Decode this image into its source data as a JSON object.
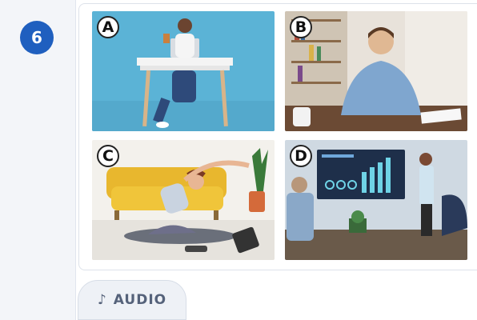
{
  "question": {
    "number": "6"
  },
  "options": [
    {
      "letter": "A",
      "icon": "person-at-desk-laptop-image"
    },
    {
      "letter": "B",
      "icon": "man-at-table-image"
    },
    {
      "letter": "C",
      "icon": "woman-yoga-stretch-image"
    },
    {
      "letter": "D",
      "icon": "business-meeting-presentation-image"
    }
  ],
  "audio": {
    "icon": "music-note-icon",
    "note_glyph": "♪",
    "label": "AUDIO"
  },
  "colors": {
    "badge": "#1f5fbf",
    "rail": "#f3f5f9",
    "audio_text": "#55627a"
  }
}
